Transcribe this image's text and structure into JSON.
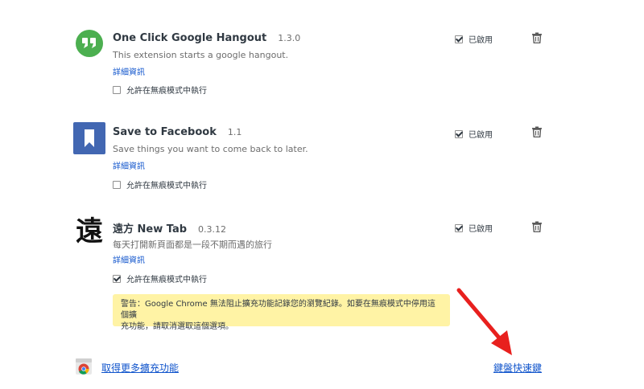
{
  "extensions": [
    {
      "name": "One Click Google Hangout",
      "version": "1.3.0",
      "description": "This extension starts a google hangout.",
      "details_label": "詳細資訊",
      "incognito_label": "允許在無痕模式中執行",
      "incognito_checked": false,
      "enabled_label": "已啟用",
      "enabled_checked": true,
      "icon": "hangouts-icon",
      "icon_color": "#4caf50"
    },
    {
      "name": "Save to Facebook",
      "version": "1.1",
      "description": "Save things you want to come back to later.",
      "details_label": "詳細資訊",
      "incognito_label": "允許在無痕模式中執行",
      "incognito_checked": false,
      "enabled_label": "已啟用",
      "enabled_checked": true,
      "icon": "bookmark-icon",
      "icon_color": "#4267b2"
    },
    {
      "name": "遠方 New Tab",
      "version": "0.3.12",
      "description": "每天打開新頁面都是一段不期而遇的旅行",
      "details_label": "詳細資訊",
      "incognito_label": "允許在無痕模式中執行",
      "incognito_checked": true,
      "enabled_label": "已啟用",
      "enabled_checked": true,
      "icon": "calligraphy-icon",
      "icon_glyph": "遠",
      "warning_line1": "警告：Google Chrome 無法阻止擴充功能記錄您的瀏覽紀錄。如要在無痕模式中停用這個擴",
      "warning_line2": "充功能，請取消選取這個選項。"
    }
  ],
  "footer": {
    "more_extensions_label": "取得更多擴充功能",
    "shortcuts_label": "鍵盤快速鍵"
  },
  "colors": {
    "link": "#1155cc",
    "warning_bg": "#fff3a5",
    "arrow": "#e8201e"
  }
}
